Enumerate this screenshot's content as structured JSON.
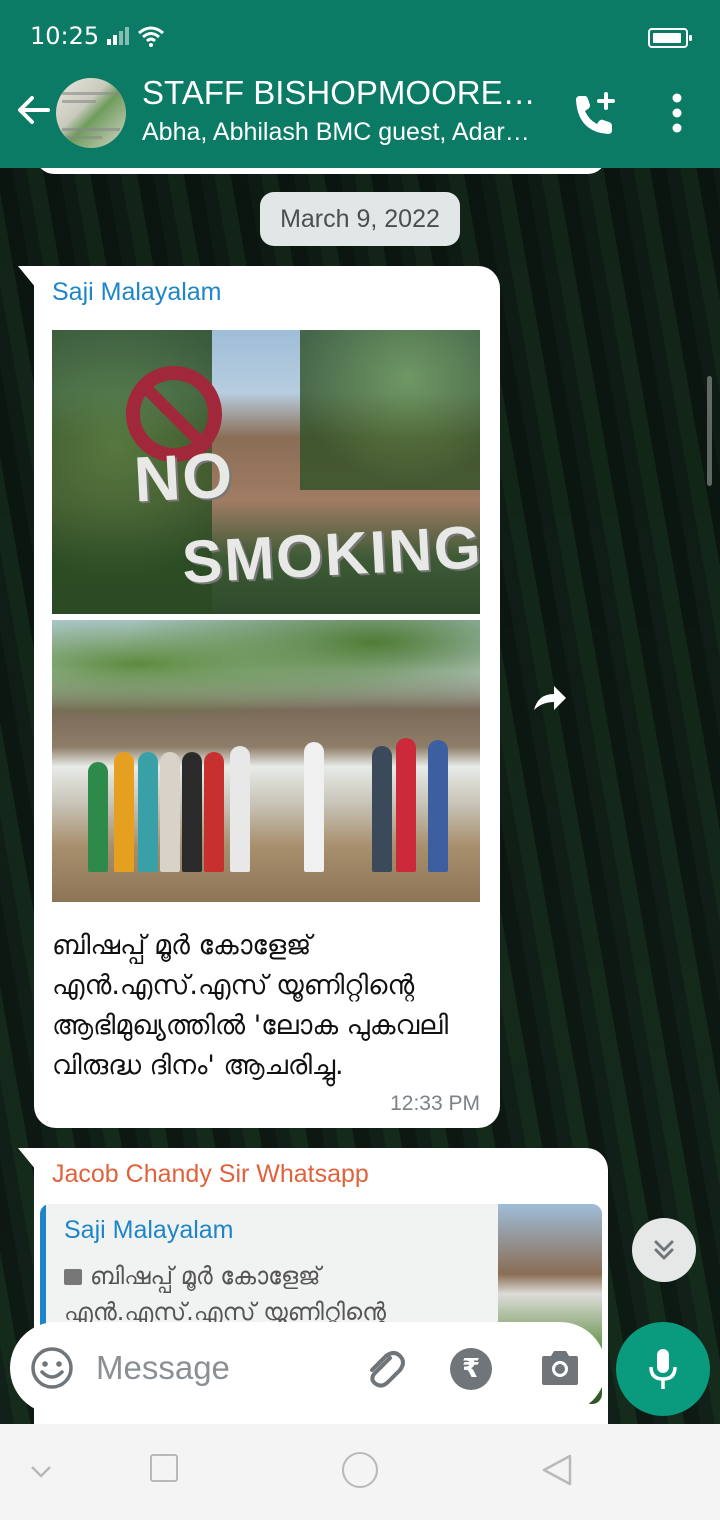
{
  "status_bar": {
    "time": "10:25"
  },
  "header": {
    "title": "STAFF BISHOPMOORE…",
    "subtitle": "Abha, Abhilash BMC guest, Adars…"
  },
  "chat": {
    "date_chip": "March 9, 2022",
    "messages": [
      {
        "sender": "Saji Malayalam",
        "image_texts": [
          "NO",
          "SMOKING"
        ],
        "caption": "ബിഷപ്പ് മൂർ കോളേജ് എൻ.എസ്.എസ് യൂണിറ്റിന്റെ ആഭിമുഖ്യത്തിൽ 'ലോക പുകവലി വിരുദ്ധ ദിനം' ആചരിച്ചു.",
        "time": "12:33 PM"
      },
      {
        "sender": "Jacob Chandy Sir Whatsapp",
        "quoted": {
          "sender": "Saji Malayalam",
          "text": "ബിഷപ്പ് മൂർ കോളേജ് എൻ.എസ്.എസ് യൂണിറ്റിന്റെ"
        }
      }
    ]
  },
  "composer": {
    "placeholder": "Message",
    "rupee_symbol": "₹"
  },
  "colors": {
    "header_bg": "#0b7b65",
    "accent_green": "#0a9a7e",
    "sender_blue": "#1e86c8",
    "sender_orange": "#e0623c"
  }
}
